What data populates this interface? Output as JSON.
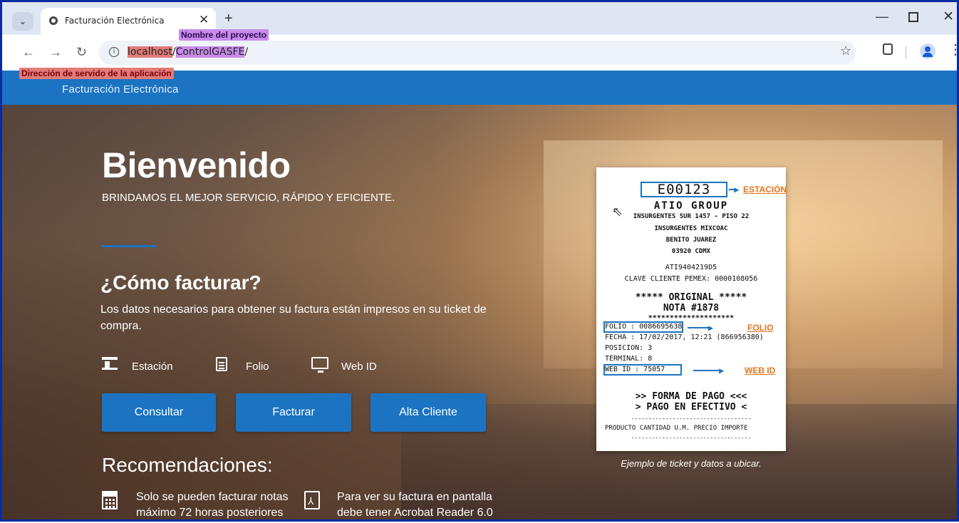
{
  "browser": {
    "tab_title": "Facturación Electrónica",
    "url_host": "localhost",
    "url_sep": "/",
    "url_project": "ControlGASFE",
    "url_trail": "/",
    "annotation_project": "Nombre del proyecto",
    "annotation_server": "Dirección de servido de la aplicación"
  },
  "site": {
    "brand": "Facturación Electrónica"
  },
  "hero": {
    "title": "Bienvenido",
    "subtitle": "BRINDAMOS EL MEJOR SERVICIO, RÁPIDO Y EFICIENTE.",
    "howto_title": "¿Cómo facturar?",
    "howto_text": "Los datos necesarios para obtener su factura están impresos en su ticket de compra.",
    "items": [
      {
        "label": "Estación",
        "icon": "station-icon"
      },
      {
        "label": "Folio",
        "icon": "document-icon"
      },
      {
        "label": "Web ID",
        "icon": "monitor-icon"
      }
    ],
    "buttons": {
      "consultar": "Consultar",
      "facturar": "Facturar",
      "alta_cliente": "Alta Cliente"
    },
    "reco_title": "Recomendaciones:",
    "recommendations": [
      {
        "text": "Solo se pueden facturar notas máximo 72 horas posteriores",
        "icon": "calendar-icon"
      },
      {
        "text": "Para ver su factura en pantalla debe tener Acrobat Reader 6.0",
        "icon": "pdf-icon"
      }
    ]
  },
  "ticket": {
    "station": "E00123",
    "station_label": "ESTACIÓN",
    "company": "ATIO GROUP",
    "addr1": "INSURGENTES SUR 1457 - PISO 22",
    "addr2": "INSURGENTES MIXCOAC",
    "addr3": "BENITO JUAREZ",
    "addr4": "03920 CDMX",
    "rfc": "ATI9404219D5",
    "client_key": "CLAVE CLIENTE PEMEX: 0000108056",
    "original": "***** ORIGINAL *****",
    "nota": "NOTA #1878",
    "stars": "********************",
    "folio": "FOLIO   : 0086695638",
    "folio_label": "FOLIO",
    "fecha": "FECHA   : 17/02/2017, 12:21 (866956380)",
    "posicion": "POSICION: 3",
    "terminal": "TERMINAL: 8",
    "webid": "WEB ID  : 75057",
    "webid_label": "WEB ID",
    "forma_pago": ">> FORMA DE PAGO <<<",
    "pago_efectivo": "> PAGO EN EFECTIVO <",
    "dashes": "-----------------------------------",
    "columns": "PRODUCTO CANTIDAD U.M. PRECIO    IMPORTE",
    "caption": "Ejemplo de ticket y datos a ubicar."
  },
  "colors": {
    "brand_blue": "#1b73c2",
    "annotation_orange": "#e8741c",
    "host_highlight": "#e47a7a",
    "project_highlight": "#c98bea"
  }
}
